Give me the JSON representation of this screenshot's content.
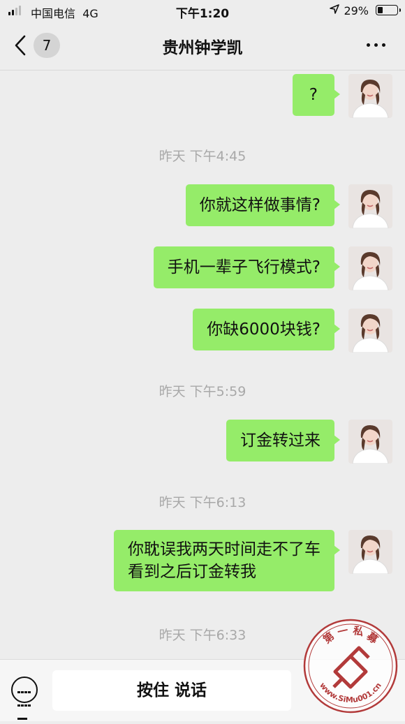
{
  "status_bar": {
    "carrier": "中国电信",
    "network": "4G",
    "time": "下午1:20",
    "battery": "29%",
    "battery_level": 0.29
  },
  "nav": {
    "back_badge": "7",
    "title": "贵州钟学凯",
    "more_icon": "more-dots-icon"
  },
  "messages": [
    {
      "type": "outgoing",
      "text": "?"
    },
    {
      "type": "time",
      "text": "昨天 下午4:45"
    },
    {
      "type": "outgoing",
      "text": "你就这样做事情?"
    },
    {
      "type": "outgoing",
      "text": "手机一辈子飞行模式?"
    },
    {
      "type": "outgoing",
      "text": "你缺6000块钱?"
    },
    {
      "type": "time",
      "text": "昨天 下午5:59"
    },
    {
      "type": "outgoing",
      "text": "订金转过来"
    },
    {
      "type": "time",
      "text": "昨天 下午6:13"
    },
    {
      "type": "outgoing",
      "lines": [
        "你耽误我两天时间走不了车",
        "看到之后订金转我"
      ]
    },
    {
      "type": "time",
      "text": "昨天 下午6:33"
    }
  ],
  "input_bar": {
    "keyboard_icon": "keyboard-icon",
    "hold_to_talk": "按住 说话"
  },
  "watermark": {
    "top_text": "第 一 私 募",
    "bottom_text": "www.SiMu001.cn"
  },
  "colors": {
    "bubble": "#95ec69",
    "background": "#ededed",
    "timestamp": "#a8a8a8"
  }
}
